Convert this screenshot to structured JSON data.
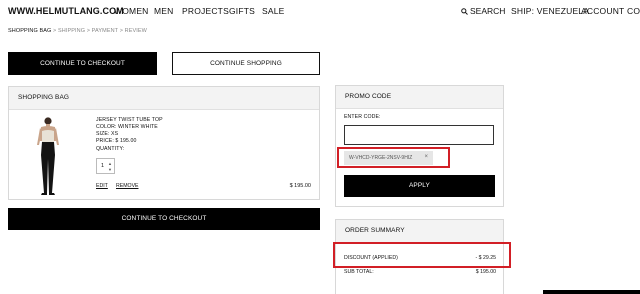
{
  "nav": {
    "brand": "WWW.HELMUTLANG.COM",
    "links": [
      "WOMEN",
      "MEN",
      "PROJECTS",
      "GIFTS",
      "SALE"
    ],
    "search": "SEARCH",
    "ship": "SHIP: VENEZUELA",
    "account": "ACCOUNT",
    "contact": "CON"
  },
  "breadcrumb": {
    "items": [
      "SHOPPING BAG",
      ">",
      "SHIPPING",
      ">",
      "PAYMENT",
      ">",
      "REVIEW"
    ]
  },
  "buttons": {
    "continue_checkout": "CONTINUE TO CHECKOUT",
    "continue_shopping": "CONTINUE SHOPPING",
    "continue_checkout_bottom": "CONTINUE TO CHECKOUT",
    "apply": "APPLY"
  },
  "bag": {
    "title": "SHOPPING BAG",
    "item": {
      "name": "JERSEY TWIST TUBE TOP",
      "color": "COLOR: WINTER WHITE",
      "size": "SIZE: XS",
      "price": "PRICE: $ 195.00",
      "quantity_label": "QUANTITY:",
      "quantity": "1",
      "edit": "EDIT",
      "remove": "REMOVE",
      "line_total": "$ 195.00"
    }
  },
  "promo": {
    "title": "PROMO CODE",
    "enter_label": "ENTER CODE:",
    "input_value": "",
    "applied_code": "W-VHCD-YRGE-2NSV-9HIZ",
    "remove_icon": "×"
  },
  "summary": {
    "title": "ORDER SUMMARY",
    "discount_label": "DISCOUNT (APPLIED)",
    "discount_value": "- $ 29.25",
    "subtotal_label": "SUB TOTAL:",
    "subtotal_value": "$ 195.00"
  },
  "colors": {
    "highlight": "#d21f26",
    "button": "#000000",
    "panel_head": "#f3f3f3"
  }
}
